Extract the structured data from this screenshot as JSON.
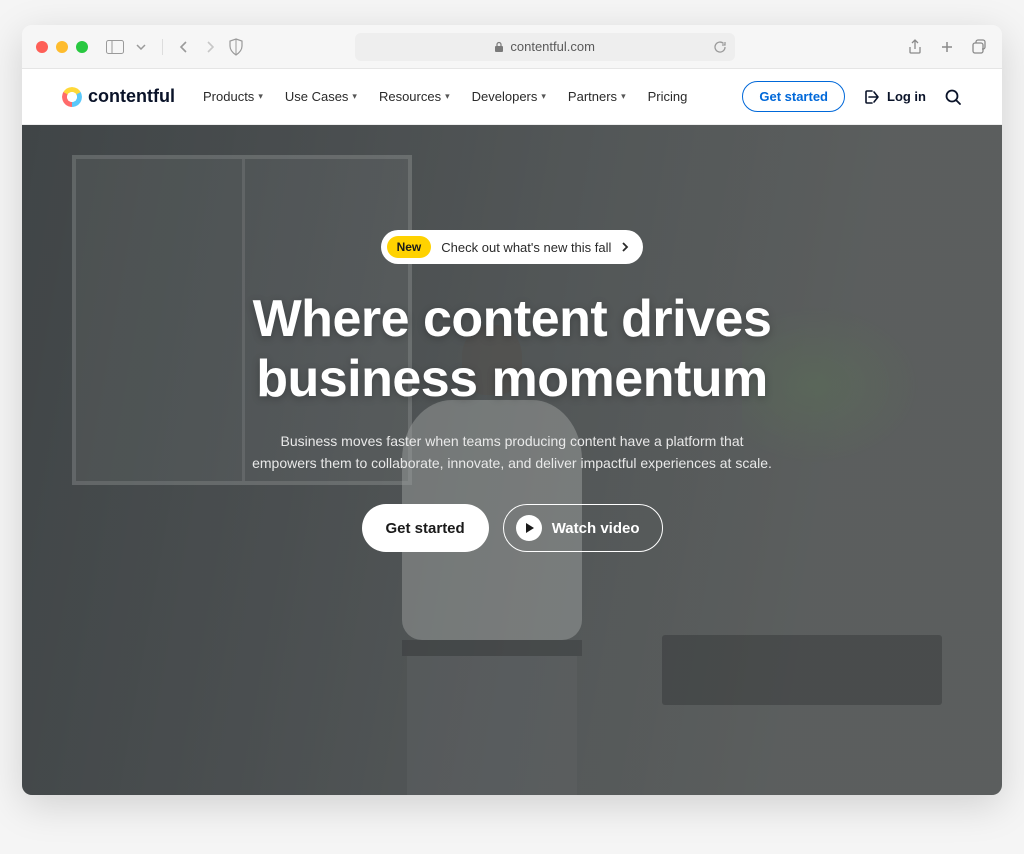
{
  "browser": {
    "url_display": "contentful.com"
  },
  "nav": {
    "brand": "contentful",
    "items": [
      {
        "label": "Products",
        "has_dropdown": true
      },
      {
        "label": "Use Cases",
        "has_dropdown": true
      },
      {
        "label": "Resources",
        "has_dropdown": true
      },
      {
        "label": "Developers",
        "has_dropdown": true
      },
      {
        "label": "Partners",
        "has_dropdown": true
      },
      {
        "label": "Pricing",
        "has_dropdown": false
      }
    ],
    "cta_get_started": "Get started",
    "login_label": "Log in"
  },
  "hero": {
    "announcement": {
      "badge": "New",
      "text": "Check out what's new this fall"
    },
    "headline_line1": "Where content drives",
    "headline_line2": "business momentum",
    "subhead": "Business moves faster when teams producing content have a platform that empowers them to collaborate, innovate, and deliver impactful experiences at scale.",
    "primary_cta": "Get started",
    "secondary_cta": "Watch video"
  }
}
